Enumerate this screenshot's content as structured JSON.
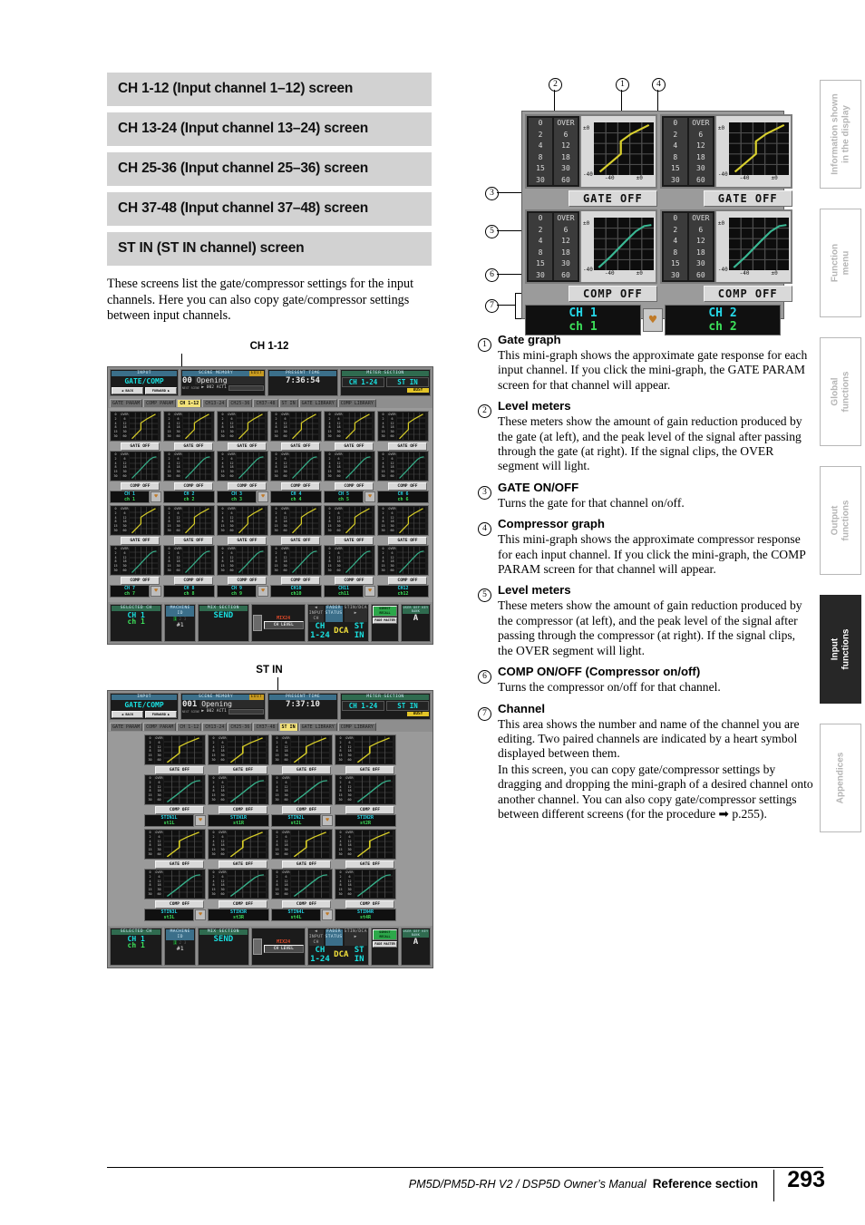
{
  "headings": [
    "CH 1-12 (Input channel 1–12) screen",
    "CH 13-24 (Input channel 13–24) screen",
    "CH 25-36 (Input channel 25–36) screen",
    "CH 37-48 (Input channel 37–48) screen",
    "ST IN (ST IN channel) screen"
  ],
  "intro": "These screens list the gate/compressor settings for the input channels. Here you can also copy gate/compressor settings between input channels.",
  "captions": {
    "ch1_12": "CH 1-12",
    "st_in": "ST IN"
  },
  "callouts": [
    {
      "num": "①",
      "title": "Gate graph",
      "paras": [
        "This mini-graph shows the approximate gate response for each input channel. If you click the mini-graph, the GATE PARAM screen for that channel will appear."
      ]
    },
    {
      "num": "②",
      "title": "Level meters",
      "paras": [
        "These meters show the amount of gain reduction produced by the gate (at left), and the peak level of the signal after passing through the gate (at right). If the signal clips, the OVER segment will light."
      ]
    },
    {
      "num": "③",
      "title": "GATE ON/OFF",
      "paras": [
        "Turns the gate for that channel on/off."
      ]
    },
    {
      "num": "④",
      "title": "Compressor graph",
      "paras": [
        "This mini-graph shows the approximate compressor response for each input channel. If you click the mini-graph, the COMP PARAM screen for that channel will appear."
      ]
    },
    {
      "num": "⑤",
      "title": "Level meters",
      "paras": [
        "These meters show the amount of gain reduction produced by the compressor (at left), and the peak level of the signal after passing through the compressor (at right). If the signal clips, the OVER segment will light."
      ]
    },
    {
      "num": "⑥",
      "title": "COMP ON/OFF (Compressor on/off)",
      "paras": [
        "Turns the compressor on/off for that channel."
      ]
    },
    {
      "num": "⑦",
      "title": "Channel",
      "paras": [
        "This area shows the number and name of the channel you are editing. Two paired channels are indicated by a heart symbol displayed between them.",
        "In this screen, you can copy gate/compressor settings by dragging and dropping the mini-graph of a desired channel onto another channel. You can also copy gate/compressor settings between different screens (for the procedure ➡ p.255)."
      ]
    }
  ],
  "diagram": {
    "numbers": [
      "①",
      "②",
      "③",
      "④",
      "⑤",
      "⑥",
      "⑦"
    ],
    "meter_left_scale": [
      "0",
      "2",
      "4",
      "8",
      "15",
      "30"
    ],
    "meter_right_scale": [
      "OVER",
      "6",
      "12",
      "18",
      "30",
      "60"
    ],
    "graph_axis_y": [
      "±0",
      "-40"
    ],
    "graph_axis_x": [
      "-40",
      "±0"
    ],
    "gate_button": "GATE OFF",
    "comp_button": "COMP OFF",
    "channels": [
      {
        "number": "CH 1",
        "name": "ch 1"
      },
      {
        "number": "CH 2",
        "name": "ch 2"
      }
    ],
    "heart_icon": "heart-icon"
  },
  "lcd_common": {
    "section_label": "INPUT",
    "function_name": "GATE/COMP",
    "back_label": "BACK",
    "forward_label": "FORWARD",
    "next_scene_label": "NEXT SCENE",
    "scene_memory_label": "SCENE MEMORY",
    "edit_badge": "EDIT",
    "present_time_label": "PRESENT TIME",
    "meter_section_label": "METER SECTION",
    "meter_left": "CH 1-24",
    "meter_right": "ST IN",
    "busy_badge": "BUSY",
    "tabs": [
      "GATE PARAM",
      "COMP PARAM",
      "CH 1-12",
      "CH13-24",
      "CH25-36",
      "CH37-48",
      "ST IN",
      "GATE LIBRARY",
      "COMP LIBRARY"
    ],
    "gate_off": "GATE OFF",
    "comp_off": "COMP OFF",
    "bottom": {
      "selected_ch_label": "SELECTED CH",
      "selected_ch_number": "CH 1",
      "selected_ch_name": "ch 1",
      "machine_id_label": "MACHINE ID",
      "machine_id_value": "#1",
      "machine_id_slots": [
        "1",
        "2",
        "3"
      ],
      "mix_section_label": "MIX SECTION",
      "send_label": "SEND",
      "mix24_label": "MIX24",
      "ch_level_label": "CH LEVEL",
      "input_ch_label": "INPUT CH",
      "fader_status_label": "FADER STATUS",
      "stin_dca_label": "STIN/DCA",
      "fader_left": "CH 1-24",
      "fader_mid": "DCA",
      "fader_right": "ST IN",
      "direct_recall_label": "DIRECT RECALL",
      "fade_master_label": "FADE MASTER",
      "user_def_label": "USER DEF KEY BANK",
      "user_def_value": "A"
    }
  },
  "shot_ch1_12": {
    "scene_number": "00",
    "scene_name": "Opening",
    "next_scene": "002 ACT1",
    "present_time": "7:36:54",
    "active_tab": "CH 1-12",
    "rows": [
      [
        {
          "number": "CH 1",
          "name": "ch 1",
          "paired": true
        },
        {
          "number": "CH 2",
          "name": "ch 2",
          "paired": false
        },
        {
          "number": "CH 3",
          "name": "ch 3",
          "paired": true
        },
        {
          "number": "CH 4",
          "name": "ch 4",
          "paired": false
        },
        {
          "number": "CH 5",
          "name": "ch 5",
          "paired": true
        },
        {
          "number": "CH 6",
          "name": "ch 6",
          "paired": false
        }
      ],
      [
        {
          "number": "CH 7",
          "name": "ch 7",
          "paired": true
        },
        {
          "number": "CH 8",
          "name": "ch 8",
          "paired": false
        },
        {
          "number": "CH 9",
          "name": "ch 9",
          "paired": true
        },
        {
          "number": "CH10",
          "name": "ch10",
          "paired": false
        },
        {
          "number": "CH11",
          "name": "ch11",
          "paired": true
        },
        {
          "number": "CH12",
          "name": "ch12",
          "paired": false
        }
      ]
    ]
  },
  "shot_st_in": {
    "scene_number": "001",
    "scene_name": "Opening",
    "next_scene": "002 ACT1",
    "present_time": "7:37:10",
    "active_tab": "ST IN",
    "rows": [
      [
        {
          "number": "STIN1L",
          "name": "st1L",
          "paired": true
        },
        {
          "number": "STIN1R",
          "name": "st1R",
          "paired": false
        },
        {
          "number": "STIN2L",
          "name": "st2L",
          "paired": true
        },
        {
          "number": "STIN2R",
          "name": "st2R",
          "paired": false
        }
      ],
      [
        {
          "number": "STIN3L",
          "name": "st3L",
          "paired": true
        },
        {
          "number": "STIN3R",
          "name": "st3R",
          "paired": false
        },
        {
          "number": "STIN4L",
          "name": "st4L",
          "paired": true
        },
        {
          "number": "STIN4R",
          "name": "st4R",
          "paired": false
        }
      ]
    ]
  },
  "side_tabs": [
    {
      "label": "Information shown\nin the display",
      "active": false
    },
    {
      "label": "Function\nmenu",
      "active": false
    },
    {
      "label": "Global\nfunctions",
      "active": false
    },
    {
      "label": "Output\nfunctions",
      "active": false
    },
    {
      "label": "Input\nfunctions",
      "active": true
    },
    {
      "label": "Appendices",
      "active": false
    }
  ],
  "footer": {
    "manual": "PM5D/PM5D-RH V2 / DSP5D Owner’s Manual",
    "section": "Reference section",
    "page": "293"
  }
}
